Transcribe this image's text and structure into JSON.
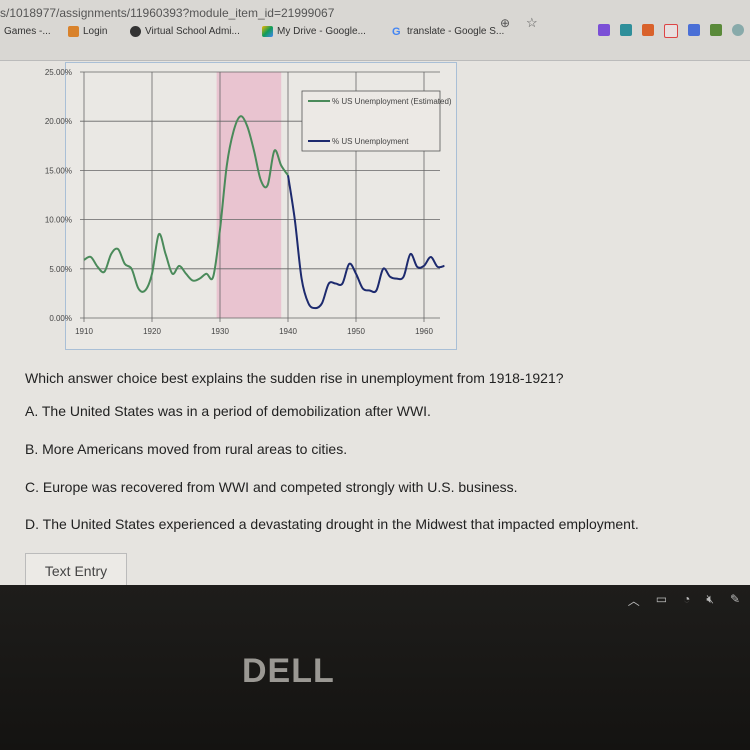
{
  "browser": {
    "url": "s/1018977/assignments/11960393?module_item_id=21999067",
    "bookmarks": [
      {
        "label": "Games -...",
        "icon": "none"
      },
      {
        "label": "Login",
        "icon": "grid-icon"
      },
      {
        "label": "Virtual School Admi...",
        "icon": "globe-icon"
      },
      {
        "label": "My Drive - Google...",
        "icon": "google-drive-icon"
      },
      {
        "label": "translate - Google S...",
        "icon": "google-icon"
      }
    ],
    "toolbar_icons": [
      "zoom-icon",
      "star-icon",
      "extension-icon",
      "extension-icon",
      "extension-icon",
      "gmail-icon",
      "docs-icon",
      "drive-icon",
      "profile-icon"
    ]
  },
  "chart_data": {
    "type": "line",
    "title": "",
    "xlabel": "",
    "ylabel": "",
    "xlim": [
      1910,
      1963
    ],
    "ylim": [
      0,
      25
    ],
    "x_ticks": [
      "1910",
      "1920",
      "1930",
      "1940",
      "1950",
      "1960"
    ],
    "y_ticks": [
      "0.00%",
      "5.00%",
      "10.00%",
      "15.00%",
      "20.00%",
      "25.00%"
    ],
    "grid": true,
    "legend_placement": "top-right",
    "shaded_region": {
      "from": 1929.5,
      "to": 1939,
      "color": "#e9c4d0"
    },
    "series": [
      {
        "name": "% US Unemployment (Estimated)",
        "color": "#4a8a5a",
        "x": [
          1910,
          1911,
          1912,
          1913,
          1914,
          1915,
          1916,
          1917,
          1918,
          1919,
          1920,
          1921,
          1922,
          1923,
          1924,
          1925,
          1926,
          1927,
          1928,
          1929,
          1930,
          1931,
          1932,
          1933,
          1934,
          1935,
          1936,
          1937,
          1938,
          1939,
          1940
        ],
        "values": [
          5.9,
          6.2,
          5.2,
          4.7,
          6.5,
          7.0,
          5.5,
          5.0,
          3.0,
          2.8,
          4.5,
          8.5,
          6.5,
          4.5,
          5.3,
          4.5,
          3.8,
          4.0,
          4.5,
          4.2,
          9.0,
          15.5,
          19.0,
          20.5,
          19.5,
          17.0,
          14.0,
          13.5,
          17.0,
          15.5,
          14.5
        ]
      },
      {
        "name": "% US Unemployment",
        "color": "#1d2a6e",
        "x": [
          1940,
          1941,
          1942,
          1943,
          1944,
          1945,
          1946,
          1947,
          1948,
          1949,
          1950,
          1951,
          1952,
          1953,
          1954,
          1955,
          1956,
          1957,
          1958,
          1959,
          1960,
          1961,
          1962,
          1963
        ],
        "values": [
          14.5,
          10.0,
          4.0,
          1.5,
          1.0,
          1.5,
          3.5,
          3.5,
          3.5,
          5.5,
          4.5,
          3.0,
          2.8,
          2.8,
          5.0,
          4.2,
          4.0,
          4.2,
          6.5,
          5.2,
          5.3,
          6.2,
          5.2,
          5.3
        ]
      }
    ]
  },
  "question": "Which answer choice best explains the sudden rise in unemployment from 1918-1921?",
  "options": [
    "A. The United States was in a period of demobilization after WWI.",
    "B. More Americans moved from rural areas to cities.",
    "C. Europe was recovered from WWI and competed strongly with U.S. business.",
    "D. The United States experienced a devastating drought in the Midwest that impacted employment."
  ],
  "text_entry_label": "Text Entry",
  "taskbar_icons": [
    "chevron-up-icon",
    "battery-icon",
    "wifi-icon",
    "volume-muted-icon",
    "pen-icon"
  ],
  "logo": "DELL"
}
